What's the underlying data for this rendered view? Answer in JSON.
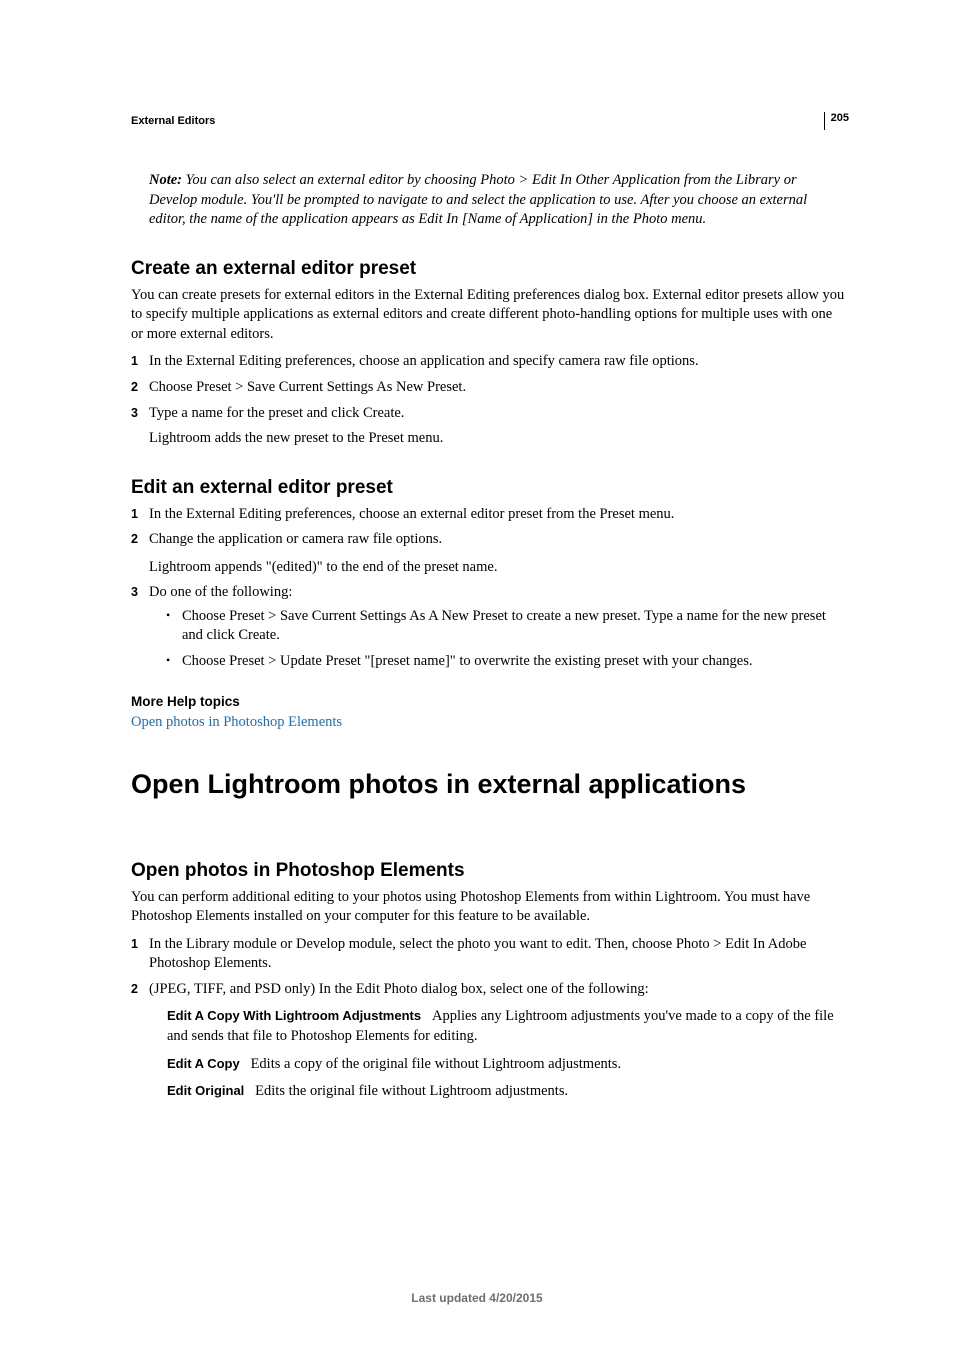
{
  "page": {
    "number": "205",
    "running_header": "External Editors",
    "footer": "Last updated 4/20/2015"
  },
  "note": {
    "label": "Note:",
    "text": "You can also select an external editor by choosing Photo > Edit In Other Application from the Library or Develop module. You'll be prompted to navigate to and select the application to use. After you choose an external editor, the name of the application appears as Edit In [Name of Application] in the Photo menu."
  },
  "section1": {
    "heading": "Create an external editor preset",
    "intro": "You can create presets for external editors in the External Editing preferences dialog box. External editor presets allow you to specify multiple applications as external editors and create different photo-handling options for multiple uses with one or more external editors.",
    "steps": [
      "In the External Editing preferences, choose an application and specify camera raw file options.",
      "Choose Preset > Save Current Settings As New Preset.",
      "Type a name for the preset and click Create."
    ],
    "after_step3": "Lightroom adds the new preset to the Preset menu."
  },
  "section2": {
    "heading": "Edit an external editor preset",
    "step1": "In the External Editing preferences, choose an external editor preset from the Preset menu.",
    "step2": "Change the application or camera raw file options.",
    "after_step2": "Lightroom appends \"(edited)\" to the end of the preset name.",
    "step3": "Do one of the following:",
    "bullets": [
      "Choose Preset > Save Current Settings As A New Preset to create a new preset. Type a name for the new preset and click Create.",
      "Choose Preset > Update Preset \"[preset name]\" to overwrite the existing preset with your changes."
    ]
  },
  "more_help": {
    "label": "More Help topics",
    "link_text": "Open photos in Photoshop Elements"
  },
  "main_heading": "Open Lightroom photos in external applications",
  "section3": {
    "heading": "Open photos in Photoshop Elements",
    "intro": "You can perform additional editing to your photos using Photoshop Elements from within Lightroom. You must have Photoshop Elements installed on your computer for this feature to be available.",
    "step1": "In the Library module or Develop module, select the photo you want to edit. Then, choose Photo > Edit In Adobe Photoshop Elements.",
    "step2": "(JPEG, TIFF, and PSD only) In the Edit Photo dialog box, select one of the following:",
    "runins": [
      {
        "label": "Edit A Copy With Lightroom Adjustments",
        "text": "Applies any Lightroom adjustments you've made to a copy of the file and sends that file to Photoshop Elements for editing."
      },
      {
        "label": "Edit A Copy",
        "text": "Edits a copy of the original file without Lightroom adjustments."
      },
      {
        "label": "Edit Original",
        "text": "Edits the original file without Lightroom adjustments."
      }
    ]
  }
}
